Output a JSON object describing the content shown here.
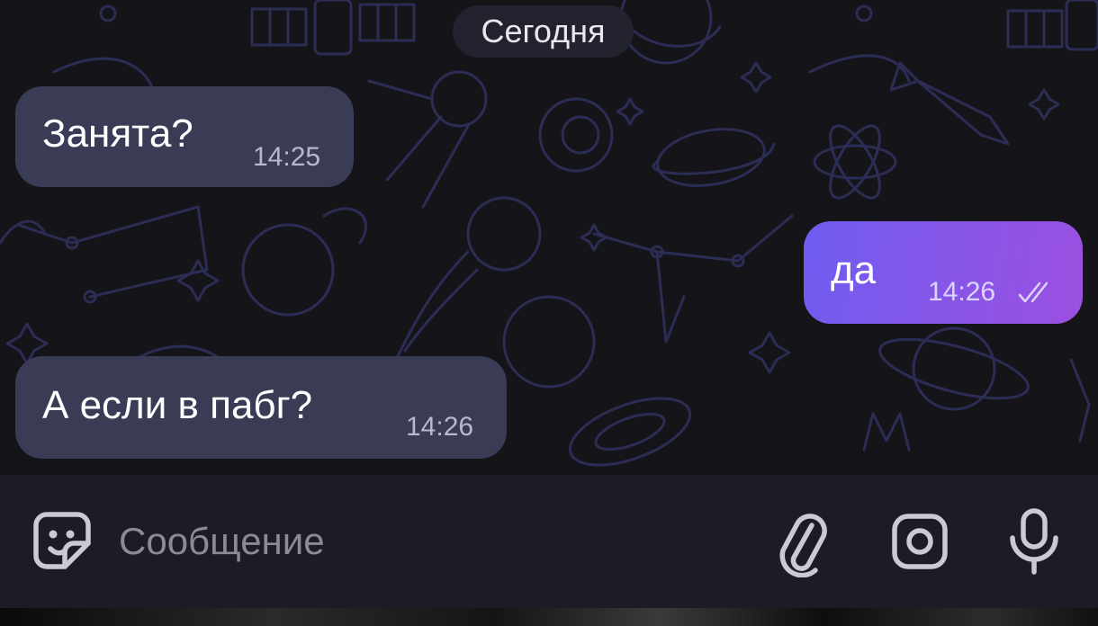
{
  "date_separator": "Сегодня",
  "messages": [
    {
      "text": "Занята?",
      "time": "14:25",
      "direction": "incoming"
    },
    {
      "text": "да",
      "time": "14:26",
      "direction": "outgoing",
      "status": "read"
    },
    {
      "text": "А если в пабг?",
      "time": "14:26",
      "direction": "incoming"
    }
  ],
  "composer": {
    "placeholder": "Сообщение",
    "value": "",
    "icons": [
      "sticker-icon",
      "paperclip-icon",
      "camera-icon",
      "microphone-icon"
    ]
  },
  "colors": {
    "background": "#141419",
    "incoming_bubble": "#3a3b55",
    "outgoing_bubble_start": "#6f5cf0",
    "outgoing_bubble_end": "#9b4fe0",
    "composer_background": "#1c1c25",
    "doodle_stroke": "#2c2d55"
  }
}
